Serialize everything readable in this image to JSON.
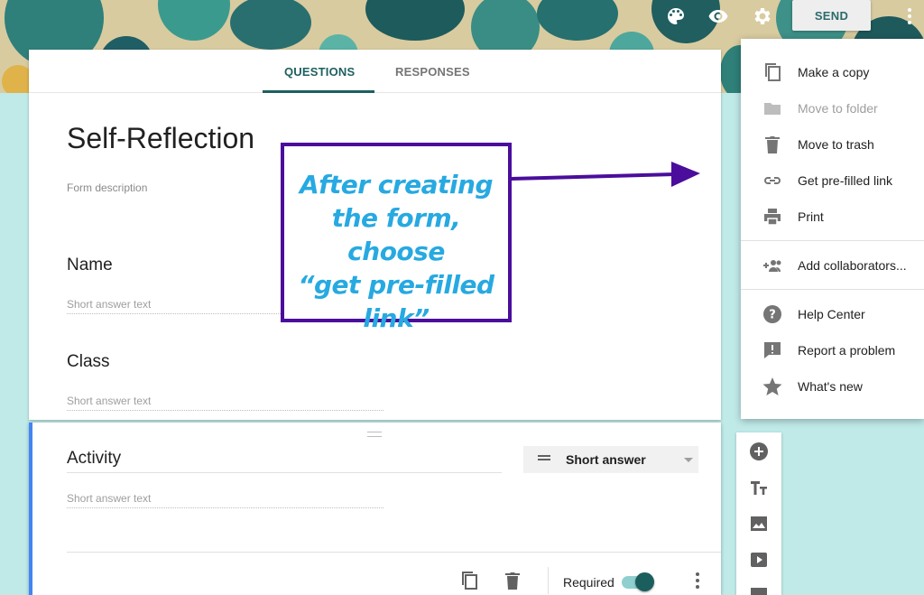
{
  "toolbar": {
    "icons": [
      "palette-icon",
      "eye-icon",
      "gear-icon"
    ],
    "send_label": "SEND"
  },
  "tabs": [
    {
      "label": "QUESTIONS",
      "active": true
    },
    {
      "label": "RESPONSES",
      "active": false
    }
  ],
  "form": {
    "title": "Self-Reflection",
    "description_placeholder": "Form description",
    "questions": [
      {
        "title": "Name",
        "hint": "Short answer text"
      },
      {
        "title": "Class",
        "hint": "Short answer text"
      }
    ],
    "active_question": {
      "title": "Activity",
      "hint": "Short answer text",
      "type": "Short answer",
      "required_label": "Required",
      "required": true
    }
  },
  "menu": {
    "items": [
      {
        "label": "Make a copy",
        "icon": "copy-icon",
        "disabled": false
      },
      {
        "label": "Move to folder",
        "icon": "folder-icon",
        "disabled": true
      },
      {
        "label": "Move to trash",
        "icon": "trash-icon",
        "disabled": false
      },
      {
        "label": "Get pre-filled link",
        "icon": "link-icon",
        "disabled": false
      },
      {
        "label": "Print",
        "icon": "print-icon",
        "disabled": false
      },
      {
        "label": "Add collaborators...",
        "icon": "add-people-icon",
        "disabled": false
      },
      {
        "label": "Help Center",
        "icon": "help-icon",
        "disabled": false
      },
      {
        "label": "Report a problem",
        "icon": "report-icon",
        "disabled": false
      },
      {
        "label": "What's new",
        "icon": "star-icon",
        "disabled": false
      }
    ]
  },
  "side_toolbar": {
    "icons": [
      "add-question-icon",
      "title-text-icon",
      "image-icon",
      "video-icon",
      "section-icon"
    ]
  },
  "annotation": {
    "lines": [
      "After creating",
      "the form, choose",
      "“get pre-filled",
      "link”"
    ]
  },
  "colors": {
    "accent": "#1e5f5f",
    "background": "#bfeae8",
    "callout_border": "#4a0d9c",
    "callout_text": "#27a9e1",
    "active_bar": "#4285f4"
  }
}
